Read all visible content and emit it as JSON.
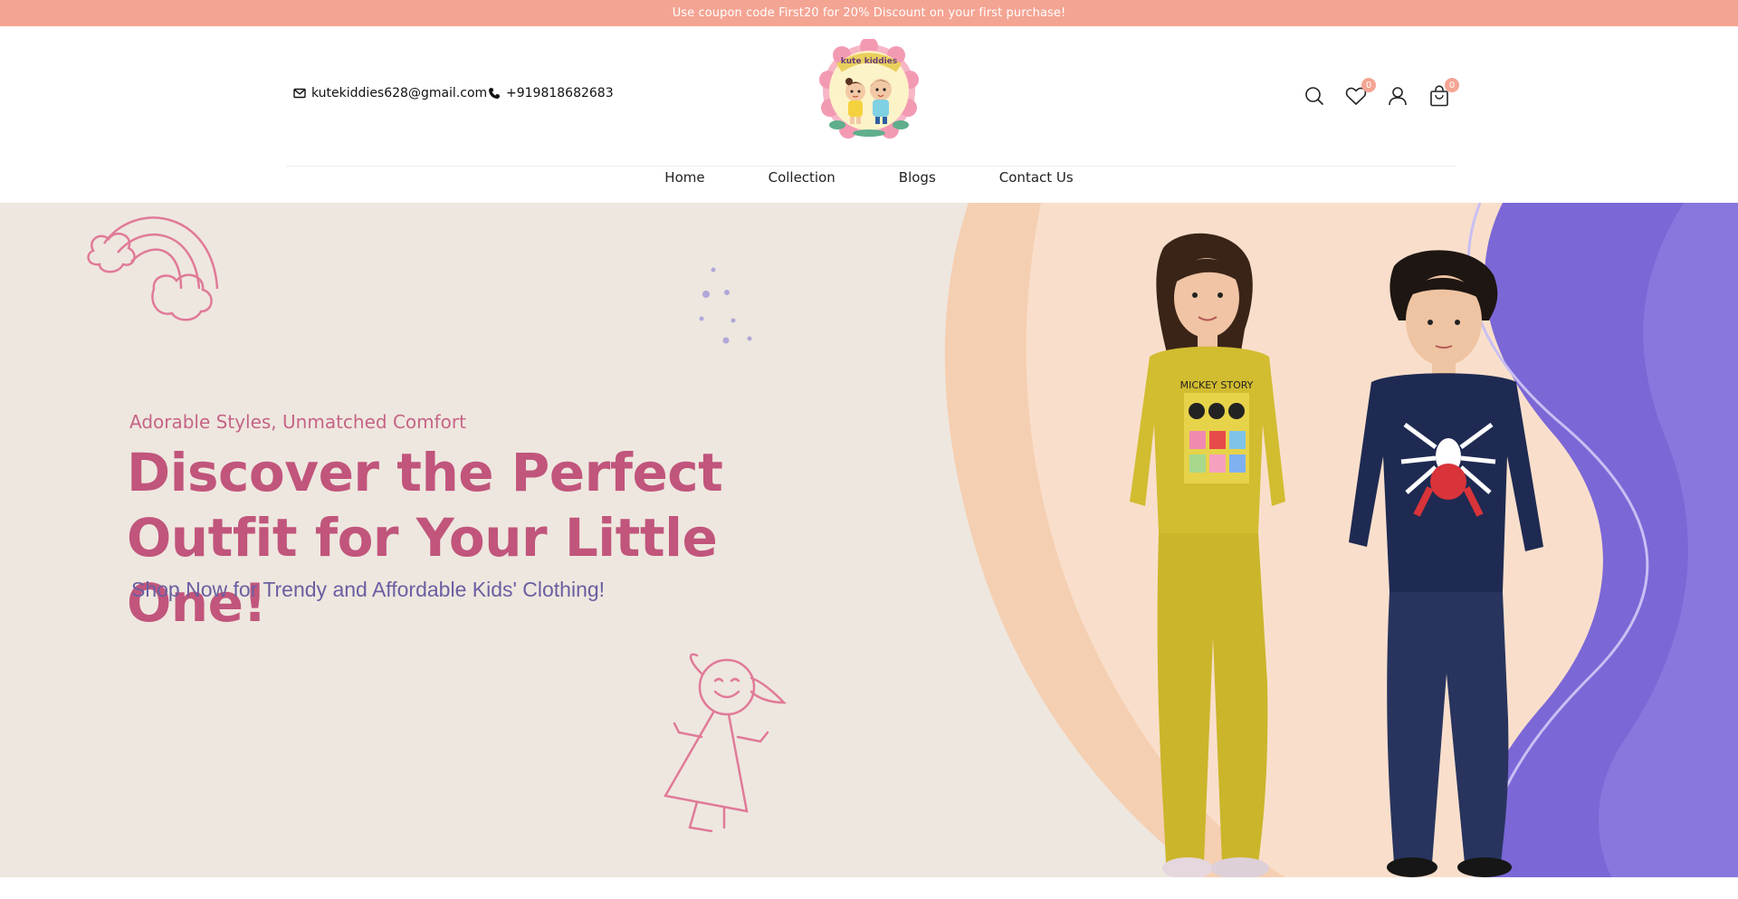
{
  "announcement": "Use coupon code First20 for 20% Discount on your first purchase!",
  "header": {
    "email": "kutekiddies628@gmail.com",
    "phone": "+919818682683",
    "logo_text": "kute kiddies",
    "wishlist_count": "0",
    "cart_count": "0"
  },
  "nav": {
    "items": [
      {
        "label": "Home"
      },
      {
        "label": "Collection"
      },
      {
        "label": "Blogs"
      },
      {
        "label": "Contact Us"
      }
    ]
  },
  "hero": {
    "subheading": "Adorable Styles, Unmatched Comfort",
    "headline_line1": "Discover the Perfect",
    "headline_line2": "Outfit for Your Little One!",
    "tagline": "Shop Now for Trendy and Affordable Kids' Clothing!",
    "girl_shirt_text": "MICKEY STORY"
  },
  "colors": {
    "announcement_bg": "#f4a493",
    "hero_bg": "#eee7df",
    "headline": "#c1557c",
    "tagline": "#6a5fa1",
    "purple_wave": "#7b67d6",
    "peach_wave": "#f5cfb2"
  },
  "icons": [
    "mail-icon",
    "phone-icon",
    "search-icon",
    "heart-icon",
    "user-icon",
    "bag-icon"
  ]
}
